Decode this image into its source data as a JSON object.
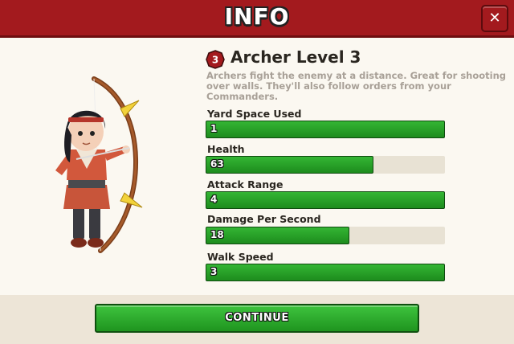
{
  "header": {
    "title": "INFO",
    "close_icon": "close-icon"
  },
  "unit": {
    "level_badge": "3",
    "title": "Archer Level 3",
    "description": "Archers fight the enemy at a distance. Great for shooting over walls. They'll also follow orders from your Commanders."
  },
  "stats": [
    {
      "label": "Yard Space Used",
      "value": "1",
      "fill_fraction": 1.0
    },
    {
      "label": "Health",
      "value": "63",
      "fill_fraction": 0.7
    },
    {
      "label": "Attack Range",
      "value": "4",
      "fill_fraction": 1.0
    },
    {
      "label": "Damage Per Second",
      "value": "18",
      "fill_fraction": 0.6
    },
    {
      "label": "Walk Speed",
      "value": "3",
      "fill_fraction": 1.0
    }
  ],
  "footer": {
    "continue_label": "CONTINUE"
  },
  "colors": {
    "header": "#a31a1e",
    "bar_green": "#2aa52a",
    "track": "#e8e2d4",
    "badge": "#a31a1e"
  }
}
